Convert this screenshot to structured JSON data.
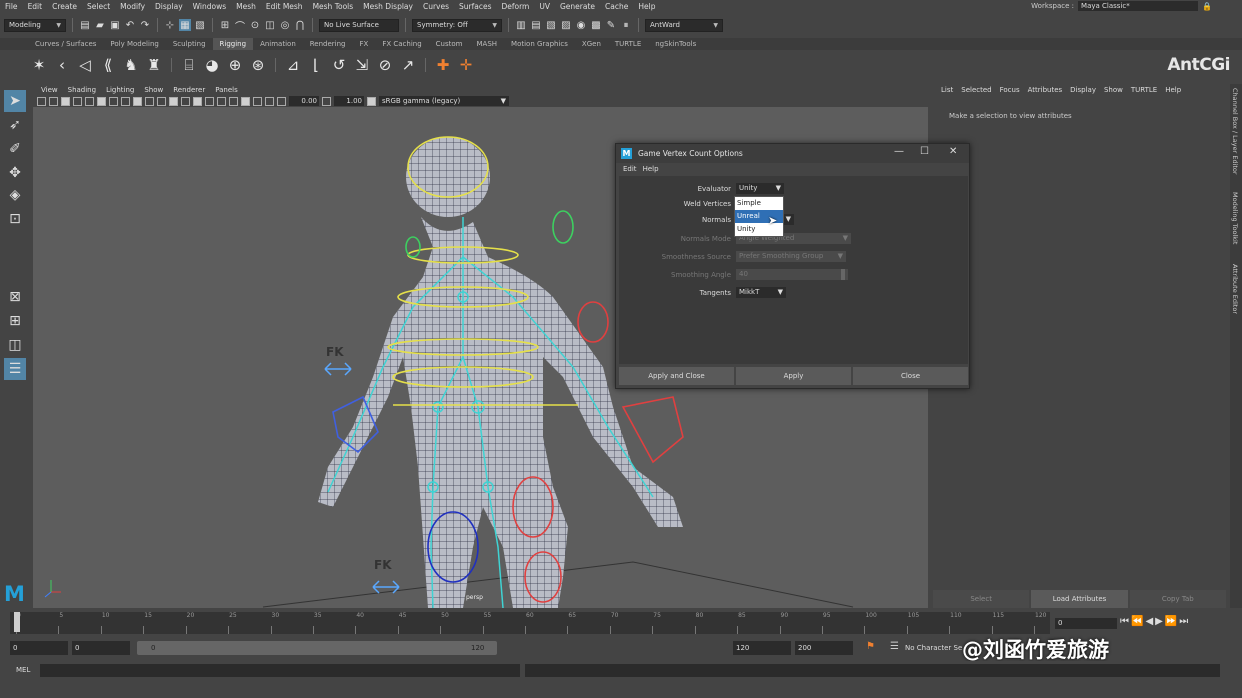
{
  "menubar": {
    "items": [
      "File",
      "Edit",
      "Create",
      "Select",
      "Modify",
      "Display",
      "Windows",
      "Mesh",
      "Edit Mesh",
      "Mesh Tools",
      "Mesh Display",
      "Curves",
      "Surfaces",
      "Deform",
      "UV",
      "Generate",
      "Cache",
      "Help"
    ],
    "workspace_label": "Workspace :",
    "workspace_value": "Maya Classic*"
  },
  "statusline": {
    "mode": "Modeling",
    "live_surface": "No Live Surface",
    "symmetry": "Symmetry: Off",
    "user": "AntWard"
  },
  "shelf": {
    "tabs": [
      "Curves / Surfaces",
      "Poly Modeling",
      "Sculpting",
      "Rigging",
      "Animation",
      "Rendering",
      "FX",
      "FX Caching",
      "Custom",
      "MASH",
      "Motion Graphics",
      "XGen",
      "TURTLE",
      "ngSkinTools"
    ],
    "active_tab": "Rigging",
    "brand": "AntCGi"
  },
  "viewport": {
    "menu": [
      "View",
      "Shading",
      "Lighting",
      "Show",
      "Renderer",
      "Panels"
    ],
    "exposure": "0.00",
    "gamma": "1.00",
    "color_space": "sRGB gamma (legacy)",
    "camera": "persp",
    "fk_label": "FK"
  },
  "attribute_editor": {
    "menu": [
      "List",
      "Selected",
      "Focus",
      "Attributes",
      "Display",
      "Show",
      "TURTLE",
      "Help"
    ],
    "message": "Make a selection to view attributes",
    "buttons": [
      "Select",
      "Load Attributes",
      "Copy Tab"
    ]
  },
  "side_tabs": [
    "Channel Box / Layer Editor",
    "Modeling Toolkit",
    "Attribute Editor"
  ],
  "dialog": {
    "title": "Game Vertex Count Options",
    "menu": [
      "Edit",
      "Help"
    ],
    "fields": {
      "evaluator_label": "Evaluator",
      "evaluator_value": "Unity",
      "evaluator_options": [
        "Simple",
        "Unreal",
        "Unity"
      ],
      "evaluator_highlight": "Unreal",
      "weld_label": "Weld Vertices",
      "normals_label": "Normals",
      "normals_mode_label": "Normals Mode",
      "normals_mode_value": "Angle Weighted",
      "smoothness_source_label": "Smoothness Source",
      "smoothness_source_value": "Prefer Smoothing Group",
      "smoothing_angle_label": "Smoothing Angle",
      "smoothing_angle_value": "40",
      "tangents_label": "Tangents",
      "tangents_value": "MikkT"
    },
    "buttons": [
      "Apply and Close",
      "Apply",
      "Close"
    ]
  },
  "timeline": {
    "ticks": [
      "0",
      "5",
      "10",
      "15",
      "20",
      "25",
      "30",
      "35",
      "40",
      "45",
      "50",
      "55",
      "60",
      "65",
      "70",
      "75",
      "80",
      "85",
      "90",
      "95",
      "100",
      "105",
      "110",
      "115",
      "120"
    ],
    "current_frame": "0"
  },
  "range": {
    "start": "0",
    "playback_start": "0",
    "bar_start": "0",
    "bar_end": "120",
    "playback_end": "120",
    "end": "200",
    "character_set": "No Character Se"
  },
  "cmdline": {
    "label": "MEL"
  },
  "watermark": "@刘函竹爱旅游",
  "colors": {
    "accent": "#5285a6",
    "maya_blue": "#24a0d8",
    "highlight": "#2f6fb5"
  }
}
